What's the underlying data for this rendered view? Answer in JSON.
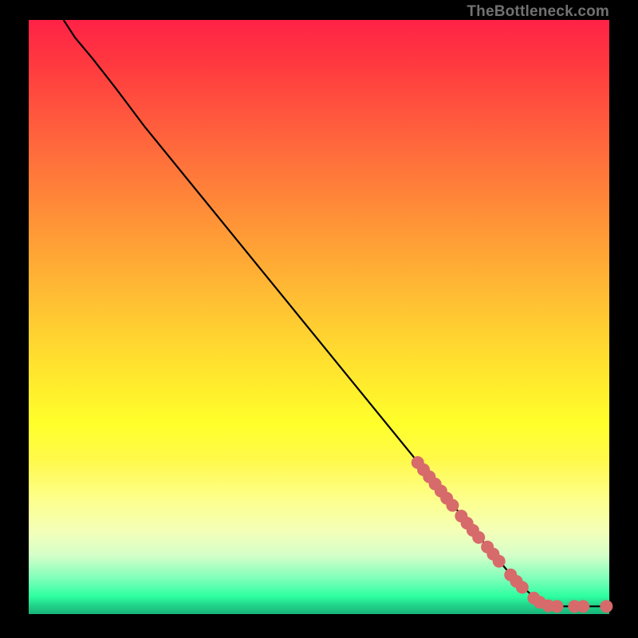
{
  "attribution": "TheBottleneck.com",
  "chart_data": {
    "type": "line",
    "title": "",
    "xlabel": "",
    "ylabel": "",
    "xlim": [
      0,
      100
    ],
    "ylim": [
      0,
      100
    ],
    "curve": [
      {
        "x": 6,
        "y": 100
      },
      {
        "x": 8,
        "y": 97
      },
      {
        "x": 11,
        "y": 93.5
      },
      {
        "x": 15,
        "y": 88.5
      },
      {
        "x": 20,
        "y": 82
      },
      {
        "x": 30,
        "y": 70
      },
      {
        "x": 40,
        "y": 58
      },
      {
        "x": 50,
        "y": 46
      },
      {
        "x": 60,
        "y": 34
      },
      {
        "x": 70,
        "y": 22
      },
      {
        "x": 78,
        "y": 12.5
      },
      {
        "x": 84,
        "y": 5.5
      },
      {
        "x": 88,
        "y": 2
      },
      {
        "x": 90,
        "y": 1.3
      },
      {
        "x": 94,
        "y": 1.3
      },
      {
        "x": 97,
        "y": 1.3
      },
      {
        "x": 100,
        "y": 1.3
      }
    ],
    "dots": [
      {
        "x": 67,
        "y": 25.5
      },
      {
        "x": 68,
        "y": 24.3
      },
      {
        "x": 69,
        "y": 23.1
      },
      {
        "x": 70,
        "y": 21.9
      },
      {
        "x": 71,
        "y": 20.7
      },
      {
        "x": 72,
        "y": 19.5
      },
      {
        "x": 73,
        "y": 18.3
      },
      {
        "x": 74.5,
        "y": 16.5
      },
      {
        "x": 75.5,
        "y": 15.3
      },
      {
        "x": 76.5,
        "y": 14.1
      },
      {
        "x": 77.5,
        "y": 12.9
      },
      {
        "x": 79,
        "y": 11.3
      },
      {
        "x": 80,
        "y": 10.1
      },
      {
        "x": 81,
        "y": 8.9
      },
      {
        "x": 83,
        "y": 6.6
      },
      {
        "x": 84,
        "y": 5.5
      },
      {
        "x": 85,
        "y": 4.5
      },
      {
        "x": 87,
        "y": 2.7
      },
      {
        "x": 88,
        "y": 2.0
      },
      {
        "x": 89.5,
        "y": 1.4
      },
      {
        "x": 91,
        "y": 1.3
      },
      {
        "x": 94,
        "y": 1.3
      },
      {
        "x": 95.5,
        "y": 1.3
      },
      {
        "x": 99.5,
        "y": 1.3
      }
    ],
    "dot_color": "#d76a6a",
    "curve_color": "#000000"
  }
}
